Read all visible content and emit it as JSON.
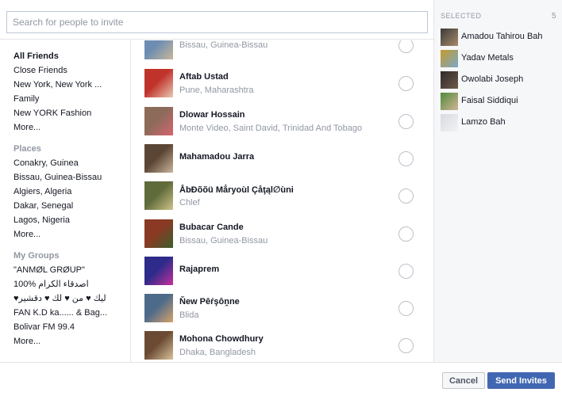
{
  "search": {
    "placeholder": "Search for people to invite",
    "value": ""
  },
  "nav": {
    "all_friends": "All Friends",
    "friends_items": [
      "Close Friends",
      "New York, New York ...",
      "Family",
      "New YORK Fashion"
    ],
    "friends_more": "More...",
    "places_heading": "Places",
    "places": [
      "Conakry, Guinea",
      "Bissau, Guinea-Bissau",
      "Algiers, Algeria",
      "Dakar, Senegal",
      "Lagos, Nigeria"
    ],
    "places_more": "More...",
    "groups_heading": "My Groups",
    "groups": [
      "\"ANMØL GRØUP\"",
      "100% اصدقاء الكرام",
      "♥ليك ♥ من ♥ لك ♥ دقشير",
      "FAN K.D ka...... & Bag...",
      "Bolivar FM 99.4"
    ],
    "groups_more": "More..."
  },
  "friends": [
    {
      "name": "",
      "location": "Bissau, Guinea-Bissau",
      "colors": [
        "#6c8db1",
        "#c9b79a"
      ]
    },
    {
      "name": "Aftab Ustad",
      "location": "Pune, Maharashtra",
      "colors": [
        "#c0332b",
        "#e8c9b4"
      ]
    },
    {
      "name": "Dlowar Hossain",
      "location": "Monte Video, Saint David, Trinidad And Tobago",
      "colors": [
        "#8d6b5a",
        "#d86470"
      ]
    },
    {
      "name": "Mahamadou Jarra",
      "location": "",
      "colors": [
        "#5b4636",
        "#c9b59a"
      ]
    },
    {
      "name": "ÅbĐõõü Mẳryoùl Çåţąl∅ùni",
      "location": "Chlef",
      "colors": [
        "#5f6b3a",
        "#cfc38a"
      ]
    },
    {
      "name": "Bubacar Cande",
      "location": "Bissau, Guinea-Bissau",
      "colors": [
        "#8a3a24",
        "#3b5f2c"
      ]
    },
    {
      "name": "Rajaprem",
      "location": "",
      "colors": [
        "#2e2b8a",
        "#c5309b"
      ]
    },
    {
      "name": "Ňew Pêŕşôṋne",
      "location": "Blida",
      "colors": [
        "#4e6a8a",
        "#d7a36c"
      ]
    },
    {
      "name": "Mohona Chowdhury",
      "location": "Dhaka, Bangladesh",
      "colors": [
        "#6b4a33",
        "#d7c29a"
      ]
    }
  ],
  "selected": {
    "heading": "SELECTED",
    "count": "5",
    "people": [
      {
        "name": "Amadou Tahirou Bah",
        "colors": [
          "#3a3a3a",
          "#a88a6a"
        ]
      },
      {
        "name": "Yadav Metals",
        "colors": [
          "#c59a2b",
          "#7aa8c8"
        ]
      },
      {
        "name": "Owolabi Joseph",
        "colors": [
          "#2e2a28",
          "#6f5a4a"
        ]
      },
      {
        "name": "Faisal Siddiqui",
        "colors": [
          "#4f8a3a",
          "#d2b497"
        ]
      },
      {
        "name": "Lamzo Bah",
        "colors": [
          "#d8dadf",
          "#f2f3f5"
        ]
      }
    ]
  },
  "footer": {
    "cancel_label": "Cancel",
    "send_label": "Send Invites"
  },
  "colors": {
    "primary": "#4267b2",
    "muted_text": "#9197a3",
    "divider": "#e5e5e5",
    "panel_bg": "#f6f7f9"
  }
}
